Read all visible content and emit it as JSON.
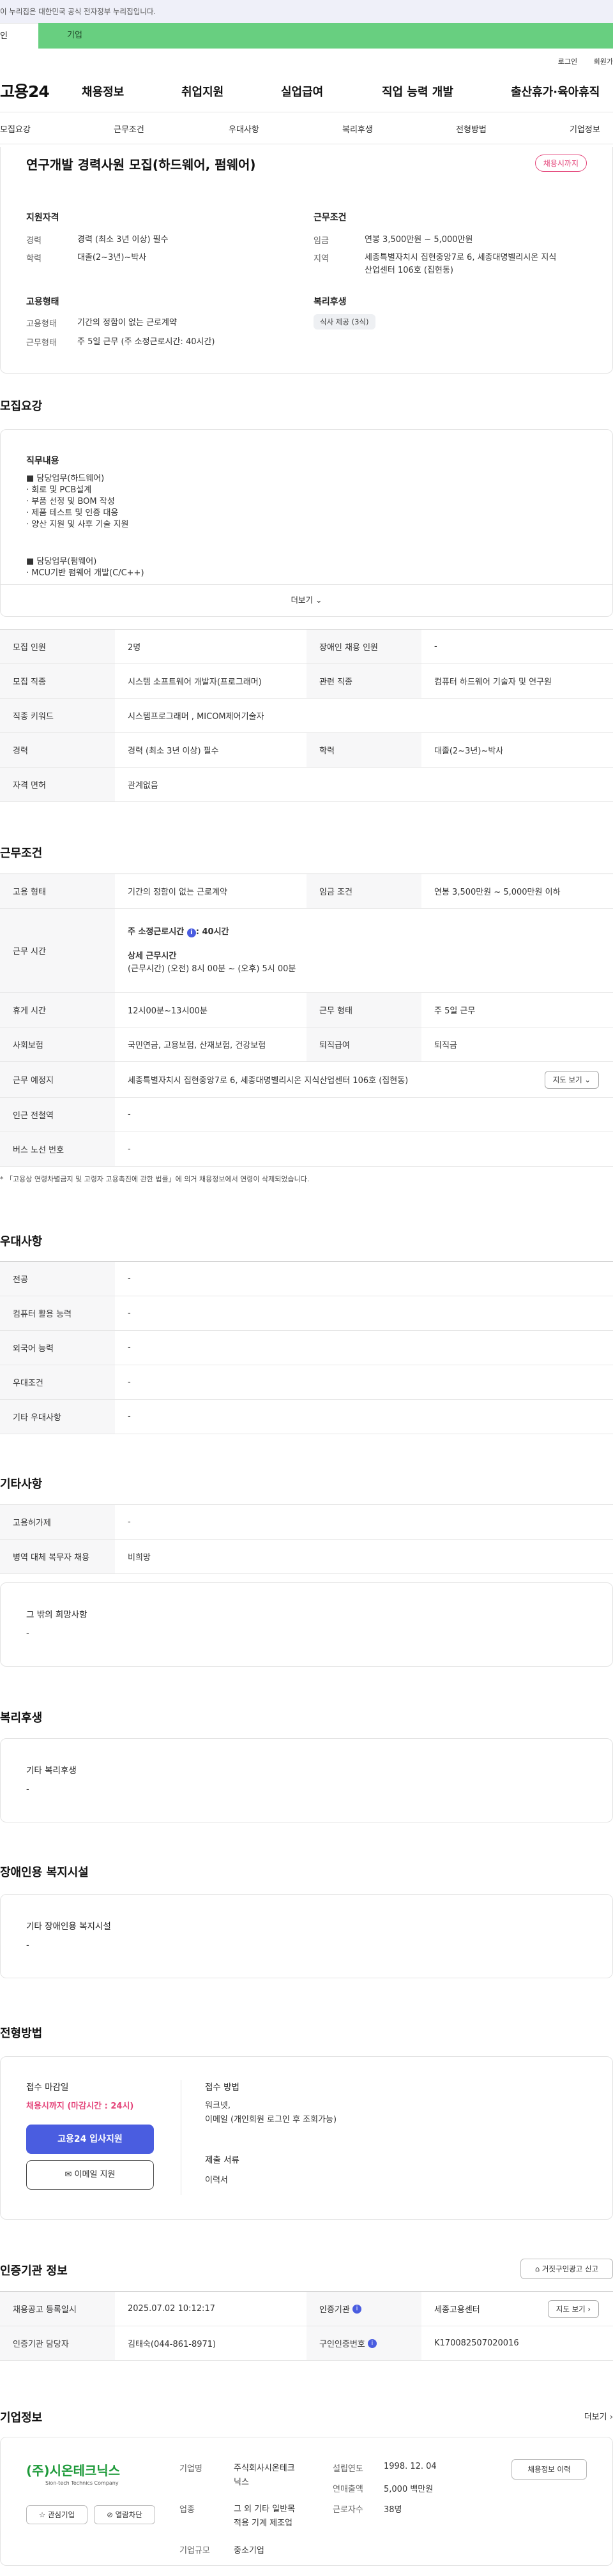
{
  "banner": "이 누리집은 대한민국 공식 전자정부 누리집입니다.",
  "top_tabs": {
    "person": "인",
    "company": "기업"
  },
  "util": {
    "login": "로그인",
    "join": "회원가"
  },
  "logo": "고용24",
  "gnb": [
    "채용정보",
    "취업지원",
    "실업급여",
    "직업 능력 개발",
    "출산휴가·육아휴직"
  ],
  "subnav": [
    "모집요강",
    "근무조건",
    "우대사항",
    "복리후생",
    "전형방법",
    "기업정보"
  ],
  "job": {
    "title": "연구개발 경력사원 모집(하드웨어, 펌웨어)",
    "badge": "채용시까지"
  },
  "qual": {
    "title": "지원자격",
    "k1": "경력",
    "v1": "경력 (최소 3년 이상) 필수",
    "k2": "학력",
    "v2": "대졸(2~3년)~박사"
  },
  "cond": {
    "title": "근무조건",
    "k1": "임금",
    "v1": "연봉 3,500만원 ~ 5,000만원",
    "k2": "지역",
    "v2a": "세종특별자치시 집현중앙7로 6, 세종대명벨리시온 지식",
    "v2b": "산업센터 106호 (집현동)"
  },
  "emp": {
    "title": "고용형태",
    "k1": "고용형태",
    "v1": "기간의 정함이 없는 근로계약",
    "k2": "근무형태",
    "v2": "주 5일 근무 (주 소정근로시간: 40시간)"
  },
  "welfare": {
    "title": "복리후생",
    "chip": "식사 제공 (3식)"
  },
  "s1": {
    "title": "모집요강"
  },
  "duty": {
    "title": "직무내용",
    "lines": [
      "■ 담당업무(하드웨어)",
      "· 회로 및 PCB설계",
      "· 부품 선정 및 BOM 작성",
      "· 제품 테스트 및 인증 대응",
      "· 양산 지원 및 사후 기술 지원",
      "",
      "■ 담당업무(펌웨어)",
      "· MCU기반 펌웨어 개발(C/C++)"
    ],
    "more": "더보기"
  },
  "t1": {
    "r1": [
      "모집 인원",
      "2명",
      "장애인 채용 인원",
      "-"
    ],
    "r2": [
      "모집 직종",
      "시스템 소프트웨어 개발자(프로그래머)",
      "관련 직종",
      "컴퓨터 하드웨어 기술자 및 연구원"
    ],
    "r3": [
      "직종 키워드",
      "시스템프로그래머 , MICOM제어기술자"
    ],
    "r4": [
      "경력",
      "경력 (최소 3년 이상) 필수",
      "학력",
      "대졸(2~3년)~박사"
    ],
    "r5": [
      "자격 면허",
      "관계없음"
    ]
  },
  "s2": {
    "title": "근무조건"
  },
  "t2": {
    "r1": [
      "고용 형태",
      "기간의 정함이 없는 근로계약",
      "임금 조건",
      "연봉 3,500만원 ~ 5,000만원 이하"
    ],
    "work": {
      "th": "근무 시간",
      "l1": "주 소정근로시간",
      "l1v": ": 40시간",
      "l2": "상세 근무시간",
      "l3": "(근무시간) (오전) 8시 00분 ~ (오후) 5시 00분"
    },
    "r3": [
      "휴게 시간",
      "12시00분~13시00분",
      "근무 형태",
      "주 5일 근무"
    ],
    "r4": [
      "사회보험",
      "국민연금, 고용보험, 산재보험, 건강보험",
      "퇴직급여",
      "퇴직금"
    ],
    "r5": [
      "근무 예정지",
      "세종특별자치시 집현중앙7로 6, 세종대명벨리시온 지식산업센터 106호 (집현동)"
    ],
    "map": "지도 보기",
    "r6": [
      "인근 전철역",
      "-"
    ],
    "r7": [
      "버스 노선 번호",
      "-"
    ]
  },
  "note": "* 「고용상 연령차별금지 및 고령자 고용촉진에 관한 법률」에 의거 채용정보에서 연령이 삭제되었습니다.",
  "s3": {
    "title": "우대사항"
  },
  "t3": [
    [
      "전공",
      "-"
    ],
    [
      "컴퓨터 활용 능력",
      "-"
    ],
    [
      "외국어 능력",
      "-"
    ],
    [
      "우대조건",
      "-"
    ],
    [
      "기타 우대사항",
      "-"
    ]
  ],
  "s4": {
    "title": "기타사항"
  },
  "t4": [
    [
      "고용허가제",
      "-"
    ],
    [
      "병역 대체 복무자 채용",
      "비희망"
    ]
  ],
  "etc_box": {
    "title": "그 밖의 희망사항",
    "value": "-"
  },
  "s5": {
    "title": "복리후생"
  },
  "wel_box": {
    "title": "기타 복리후생",
    "value": "-"
  },
  "s6": {
    "title": "장애인용 복지시설"
  },
  "dis_box": {
    "title": "기타 장애인용 복지시설",
    "value": "-"
  },
  "s7": {
    "title": "전형방법"
  },
  "apply": {
    "deadline_title": "접수 마감일",
    "deadline": "채용시까지 (마감시간 : 24시)",
    "btn": "고용24 입사지원",
    "mail": "이메일 지원",
    "method_title": "접수 방법",
    "method1": "워크넷,",
    "method2": "이메일 (개인회원 로그인 후 조회가능)",
    "docs_title": "제출 서류",
    "docs": "이력서"
  },
  "s8": {
    "title": "인증기관 정보",
    "report": "거짓구인광고 신고"
  },
  "t8": {
    "r1": [
      "채용공고 등록일시",
      "2025.07.02 10:12:17",
      "인증기관",
      "세종고용센터"
    ],
    "map": "지도 보기",
    "r2": [
      "인증기관 담당자",
      "김태숙(044-861-8971)",
      "구인인증번호",
      "K170082507020016"
    ]
  },
  "s9": {
    "title": "기업정보",
    "more": "더보기"
  },
  "company": {
    "logo_text": "(주)시온테크닉스",
    "logo_sub": "Sion-tech Technics Company",
    "fav": "관심기업",
    "block": "열람차단",
    "kind_k": "기업명",
    "kind_v1": "주식회사시온테크",
    "kind_v2": "닉스",
    "ind_k": "업종",
    "ind_v1": "그 외 기타 일반목",
    "ind_v2": "적용 기계 제조업",
    "size_k": "기업규모",
    "size_v": "중소기업",
    "est_k": "설립연도",
    "est_v": "1998. 12. 04",
    "rev_k": "연매출액",
    "rev_v": "5,000 백만원",
    "emp_k": "근로자수",
    "emp_v": "38명",
    "hist": "채용정보 이력"
  },
  "colors": {
    "accent": "#4a5de0",
    "badge": "#e4457a",
    "company_tab": "#68cf80",
    "deadline": "#e4457a"
  }
}
